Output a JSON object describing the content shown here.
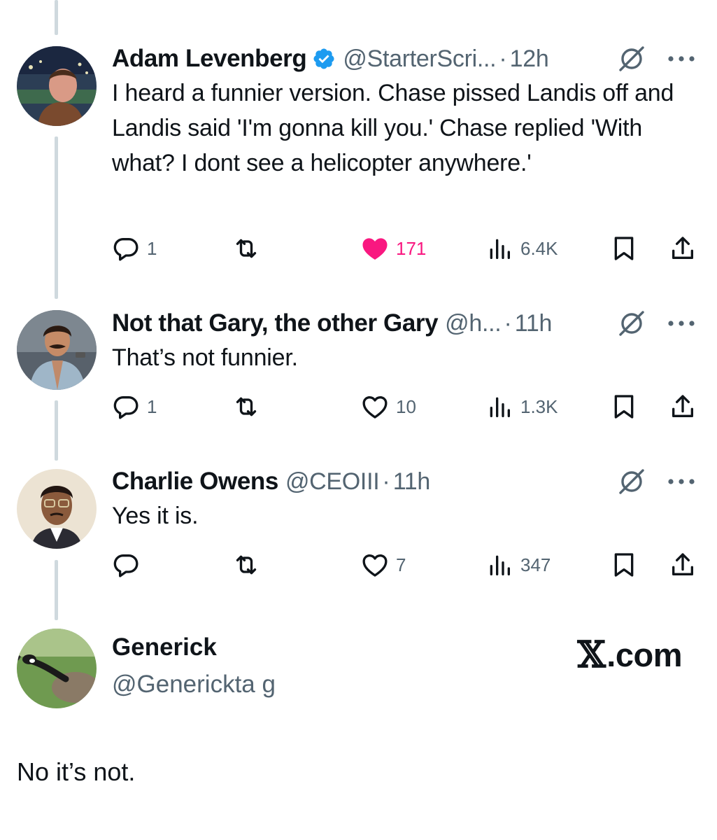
{
  "tweets": [
    {
      "name": "Adam Levenberg",
      "verified": true,
      "handle": "@StarterScri...",
      "time": "12h",
      "text": "I heard a funnier version. Chase pissed Landis off and Landis said 'I'm gonna kill you.'  Chase replied 'With what? I dont see a helicopter anywhere.'",
      "replies": "1",
      "reposts": "",
      "likes": "171",
      "liked": true,
      "views": "6.4K"
    },
    {
      "name": "Not that Gary, the other Gary",
      "verified": false,
      "handle": "@h...",
      "time": "11h",
      "text": "That’s not funnier.",
      "replies": "1",
      "reposts": "",
      "likes": "10",
      "liked": false,
      "views": "1.3K"
    },
    {
      "name": "Charlie Owens",
      "verified": false,
      "handle": "@CEOIII",
      "time": "11h",
      "text": "Yes it is.",
      "replies": "",
      "reposts": "",
      "likes": "7",
      "liked": false,
      "views": "347"
    }
  ],
  "watermark": {
    "name": "Generick",
    "handle": "@Generickta g",
    "site_mark": "𝕏",
    "site_suffix": ".com"
  },
  "caption": "No it’s not.",
  "colors": {
    "like": "#f91880",
    "verified": "#1d9bf0",
    "secondary_text": "#536471",
    "thread_line": "#cfd9de"
  }
}
